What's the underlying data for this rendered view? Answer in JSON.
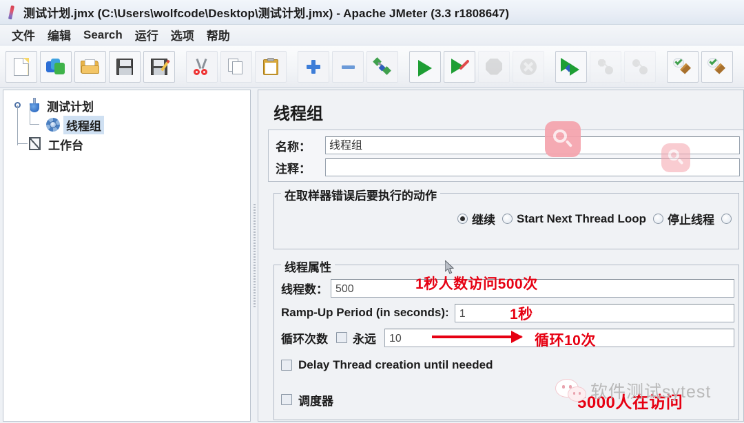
{
  "window": {
    "title": "测试计划.jmx (C:\\Users\\wolfcode\\Desktop\\测试计划.jmx) - Apache JMeter (3.3 r1808647)",
    "app_icon": "jmeter-feather-icon"
  },
  "menubar": {
    "items": [
      {
        "label": "文件",
        "name": "menu-file"
      },
      {
        "label": "编辑",
        "name": "menu-edit"
      },
      {
        "label": "Search",
        "name": "menu-search"
      },
      {
        "label": "运行",
        "name": "menu-run"
      },
      {
        "label": "选项",
        "name": "menu-options"
      },
      {
        "label": "帮助",
        "name": "menu-help"
      }
    ]
  },
  "toolbar": {
    "buttons": [
      {
        "icon": "new-document-icon",
        "name": "toolbar-new"
      },
      {
        "icon": "templates-icon",
        "name": "toolbar-templates"
      },
      {
        "icon": "open-folder-icon",
        "name": "toolbar-open"
      },
      {
        "icon": "save-icon",
        "name": "toolbar-save"
      },
      {
        "icon": "save-as-icon",
        "name": "toolbar-save-as"
      },
      {
        "icon": "scissors-cut-icon",
        "name": "toolbar-cut"
      },
      {
        "icon": "copy-icon",
        "name": "toolbar-copy"
      },
      {
        "icon": "clipboard-paste-icon",
        "name": "toolbar-paste"
      },
      {
        "icon": "plus-expand-icon",
        "name": "toolbar-expand-all"
      },
      {
        "icon": "minus-collapse-icon",
        "name": "toolbar-collapse-all"
      },
      {
        "icon": "toggle-icon",
        "name": "toolbar-toggle"
      },
      {
        "icon": "play-start-icon",
        "name": "toolbar-start"
      },
      {
        "icon": "play-start-no-pause-icon",
        "name": "toolbar-start-no-pauses"
      },
      {
        "icon": "stop-octagon-icon",
        "name": "toolbar-stop"
      },
      {
        "icon": "shutdown-icon",
        "name": "toolbar-shutdown"
      },
      {
        "icon": "start-remote-all-icon",
        "name": "toolbar-remote-start-all"
      },
      {
        "icon": "stop-remote-all-icon",
        "name": "toolbar-remote-stop-all"
      },
      {
        "icon": "shutdown-remote-all-icon",
        "name": "toolbar-remote-shutdown-all"
      },
      {
        "icon": "clear-icon",
        "name": "toolbar-clear"
      },
      {
        "icon": "clear-all-icon",
        "name": "toolbar-clear-all"
      }
    ]
  },
  "tree": {
    "nodes": [
      {
        "label": "测试计划",
        "icon": "test-plan-flask-icon",
        "selected": false,
        "name": "tree-node-test-plan"
      },
      {
        "label": "线程组",
        "icon": "thread-group-gear-icon",
        "selected": true,
        "name": "tree-node-thread-group"
      },
      {
        "label": "工作台",
        "icon": "workbench-icon",
        "selected": false,
        "name": "tree-node-workbench"
      }
    ]
  },
  "detail": {
    "panel_title": "线程组",
    "name_label": "名称：",
    "name_value": "线程组",
    "comment_label": "注释：",
    "comment_value": "",
    "error_action": {
      "title": "在取样器错误后要执行的动作",
      "options": [
        {
          "label": "继续",
          "selected": true,
          "name": "radio-continue"
        },
        {
          "label": "Start Next Thread Loop",
          "selected": false,
          "name": "radio-start-next-thread-loop"
        },
        {
          "label": "停止线程",
          "selected": false,
          "name": "radio-stop-thread"
        }
      ]
    },
    "thread_properties": {
      "title": "线程属性",
      "thread_count_label": "线程数：",
      "thread_count_value": "500",
      "ramp_up_label": "Ramp-Up Period (in seconds):",
      "ramp_up_value": "1",
      "loop_label": "循环次数",
      "forever_label": "永远",
      "forever_checked": false,
      "loop_value": "10",
      "delay_thread_label": "Delay Thread creation until needed",
      "delay_thread_checked": false,
      "scheduler_label": "调度器",
      "scheduler_checked": false
    }
  },
  "annotations": {
    "color": "#e60012",
    "thread_count_note": "1秒人数访问500次",
    "ramp_up_note": "1秒",
    "loop_note": "循环10次",
    "bottom_note": "5000人在访问"
  },
  "watermarks": {
    "wechat_text": "软件测试sytest",
    "wechat_icon": "wechat-bubbles-icon",
    "search_icon": "magnifier-icon",
    "search_badge_color": "#f5a3ad"
  }
}
